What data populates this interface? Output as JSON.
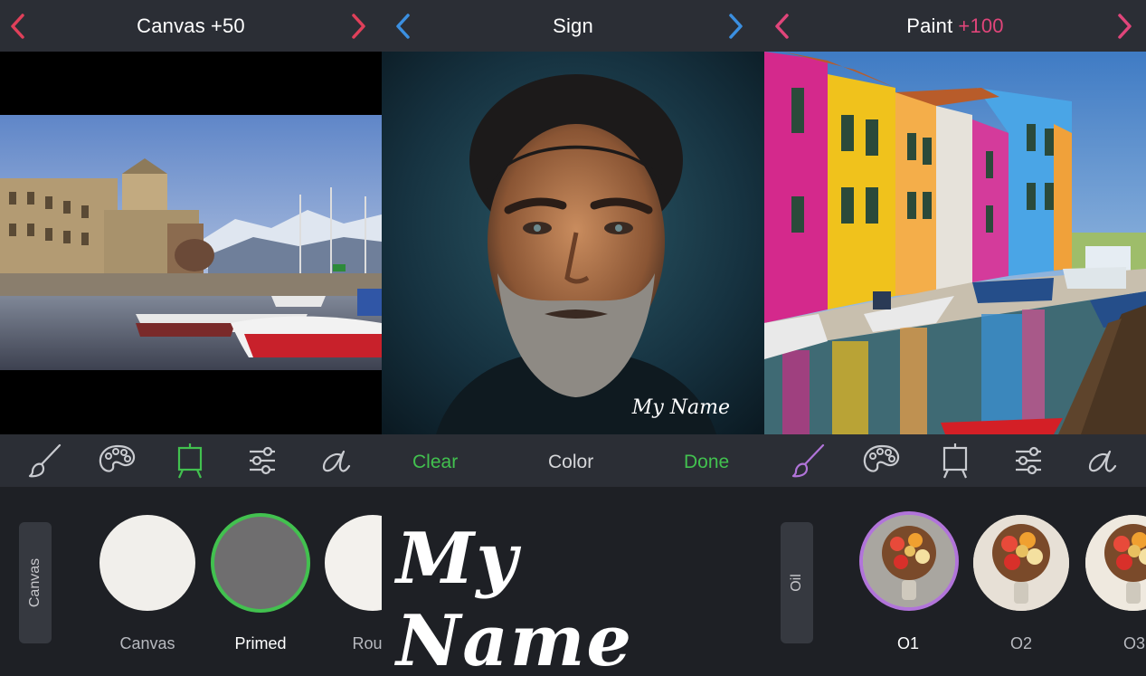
{
  "colors": {
    "red_accent": "#e0405a",
    "blue_accent": "#3b8fe0",
    "green_accent": "#42c14f",
    "pink_accent": "#e0457a",
    "purple_accent": "#b174d9"
  },
  "panel_canvas": {
    "title": "Canvas",
    "title_delta": "+50",
    "tools": [
      "brush-icon",
      "palette-icon",
      "easel-icon",
      "sliders-icon",
      "script-a-icon"
    ],
    "side_tab": "Canvas",
    "swatches": [
      {
        "label": "Canvas",
        "selected": false
      },
      {
        "label": "Primed",
        "selected": true
      },
      {
        "label": "Roug",
        "selected": false
      }
    ]
  },
  "panel_sign": {
    "title": "Sign",
    "overlay_signature": "My Name",
    "actions": {
      "clear": "Clear",
      "color": "Color",
      "done": "Done"
    },
    "signature": "My Name"
  },
  "panel_paint": {
    "title": "Paint",
    "title_delta": "+100",
    "tools": [
      "brush-icon",
      "palette-icon",
      "easel-icon",
      "sliders-icon",
      "script-a-icon"
    ],
    "side_tab": "Oil",
    "swatches": [
      {
        "label": "O1",
        "selected": true
      },
      {
        "label": "O2",
        "selected": false
      },
      {
        "label": "O3",
        "selected": false
      }
    ]
  }
}
